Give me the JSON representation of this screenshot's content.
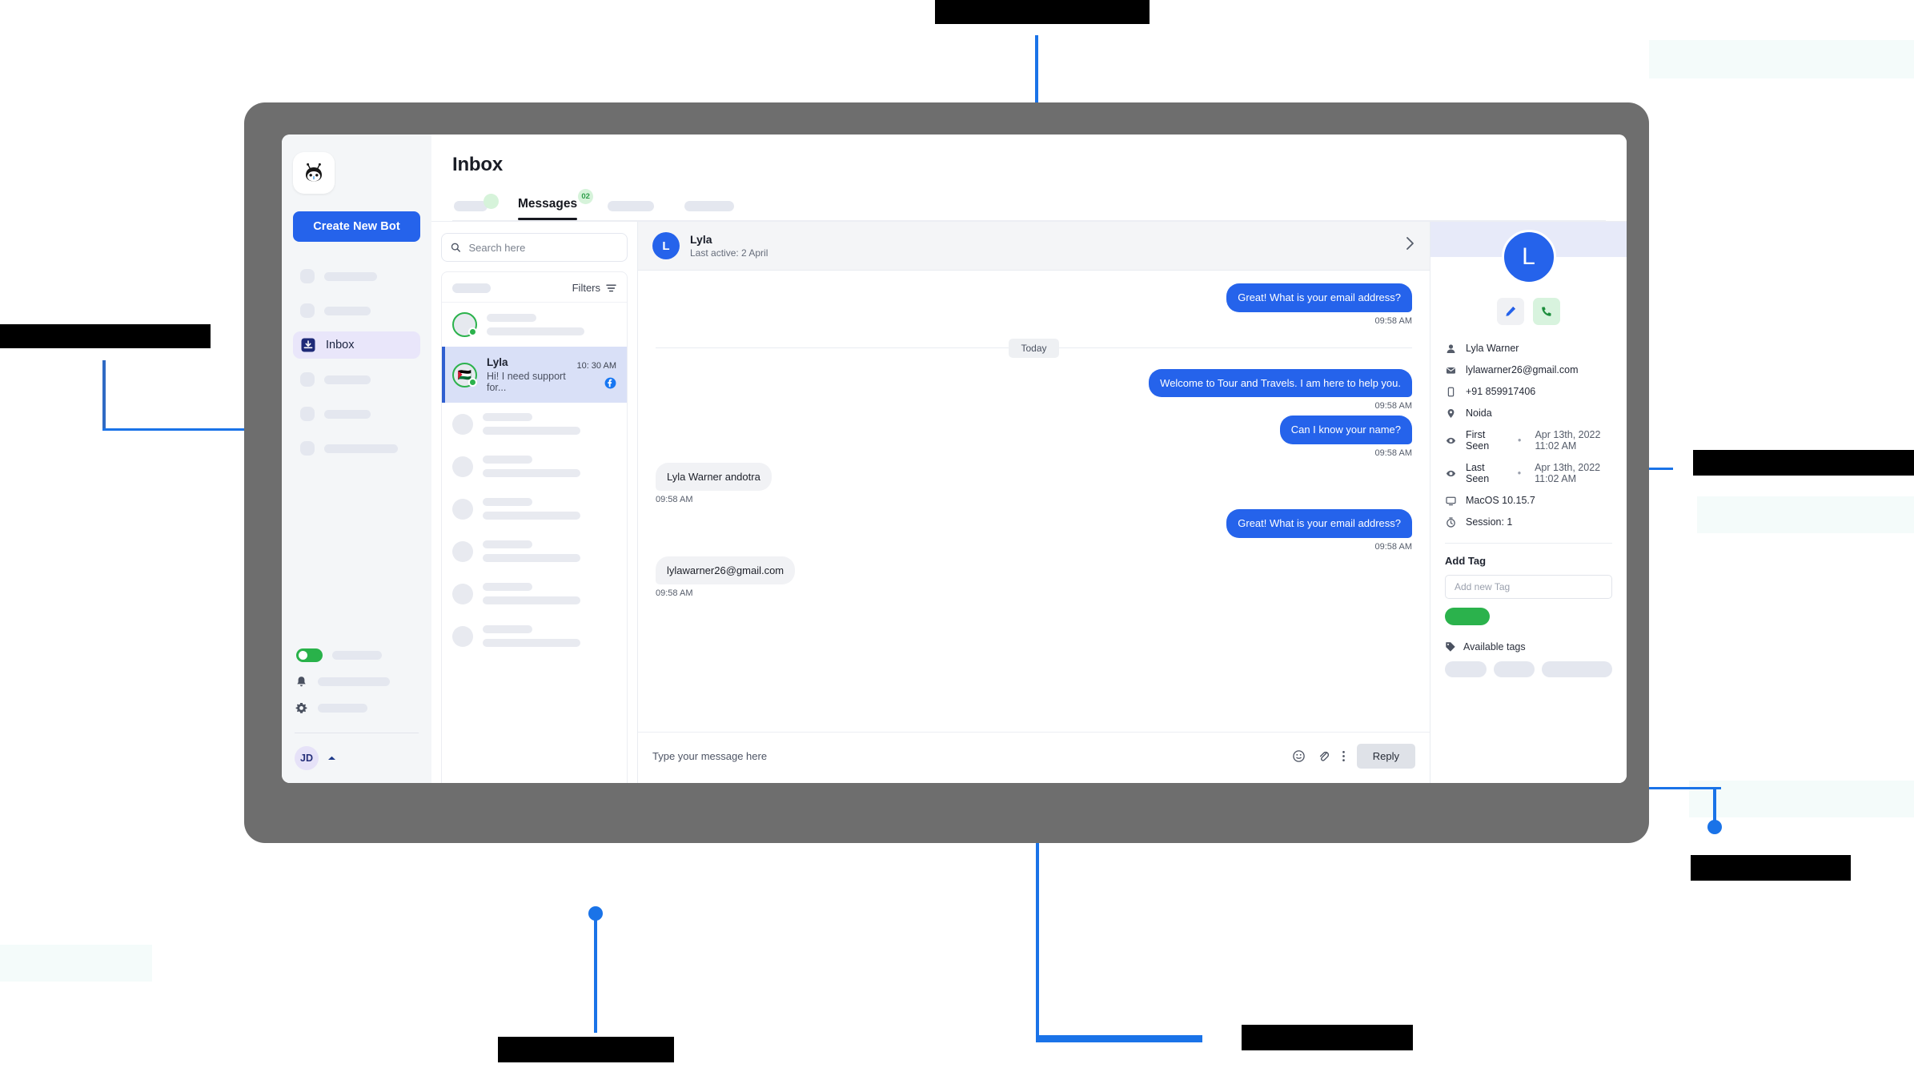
{
  "sidebar": {
    "logo_icon": "bot-mascot-icon",
    "create_button": "Create New Bot",
    "active_item": {
      "label": "Inbox",
      "icon": "inbox-icon"
    },
    "skeleton_items_above": 2,
    "skeleton_items_below": 3,
    "toggle_state": "on",
    "bell_icon": "bell-icon",
    "gear_icon": "gear-icon",
    "user_initials": "JD",
    "user_chevron": "chevron-up-icon"
  },
  "header": {
    "title": "Inbox"
  },
  "tabs": [
    {
      "label": "",
      "type": "skeleton",
      "has_green_dot": true
    },
    {
      "label": "Messages",
      "type": "text",
      "active": true,
      "badge": "02"
    },
    {
      "label": "",
      "type": "skeleton"
    },
    {
      "label": "",
      "type": "skeleton"
    }
  ],
  "conversation_list": {
    "search_placeholder": "Search here",
    "search_value": "",
    "search_icon": "search-icon",
    "filters_label": "Filters",
    "filters_icon": "filter-icon",
    "items": [
      {
        "name": "Lyla",
        "snippet": "Hi! I need support for...",
        "time": "10: 30 AM",
        "channel_icon": "facebook-icon",
        "avatar_emoji": "🇵🇸",
        "selected": true,
        "online": true
      }
    ],
    "skeleton_rows": 6
  },
  "chat": {
    "contact_name": "Lyla",
    "contact_status": "Last active: 2 April",
    "avatar_initial": "L",
    "expand_icon": "chevron-right-icon",
    "day_separator": "Today",
    "messages": [
      {
        "dir": "out",
        "text": "Great! What is your email address?",
        "time": "09:58 AM"
      },
      {
        "dir": "out",
        "text": "Welcome to Tour and Travels. I am here to help you.",
        "time": "09:58 AM"
      },
      {
        "dir": "out",
        "text": "Can I know your name?",
        "time": "09:58 AM"
      },
      {
        "dir": "in",
        "text": "Lyla Warner andotra",
        "time": "09:58 AM"
      },
      {
        "dir": "out",
        "text": "Great! What is your email address?",
        "time": "09:58 AM"
      },
      {
        "dir": "in",
        "text": "lylawarner26@gmail.com",
        "time": "09:58 AM"
      }
    ],
    "composer": {
      "placeholder": "Type your message here",
      "emoji_icon": "emoji-icon",
      "attach_icon": "paperclip-icon",
      "more_icon": "more-vertical-icon",
      "reply_label": "Reply"
    }
  },
  "details": {
    "avatar_initial": "L",
    "edit_icon": "pencil-icon",
    "call_icon": "phone-icon",
    "fields": [
      {
        "icon": "person-icon",
        "label": "Lyla Warner",
        "value": ""
      },
      {
        "icon": "mail-icon",
        "label": "lylawarner26@gmail.com",
        "value": ""
      },
      {
        "icon": "phone-icon",
        "label": "+91 859917406",
        "value": ""
      },
      {
        "icon": "pin-icon",
        "label": "Noida",
        "value": ""
      },
      {
        "icon": "eye-icon",
        "label": "First Seen",
        "sep": "•",
        "value": "Apr 13th, 2022 11:02 AM"
      },
      {
        "icon": "eye-icon",
        "label": "Last Seen",
        "sep": "•",
        "value": "Apr 13th, 2022 11:02 AM"
      },
      {
        "icon": "monitor-icon",
        "label": "MacOS 10.15.7",
        "value": ""
      },
      {
        "icon": "timer-icon",
        "label": "Session: 1",
        "value": ""
      }
    ],
    "tag_section_title": "Add Tag",
    "tag_input_placeholder": "Add new Tag",
    "tag_input_value": "",
    "add_tag_button_color": "#2bb24c",
    "available_tags_label": "Available tags",
    "available_tags_icon": "tag-icon",
    "available_tag_chips": 3
  },
  "annotations": [
    {
      "name": "default-inbox-callout",
      "position": "top"
    },
    {
      "name": "visitor-status-callout",
      "position": "left"
    },
    {
      "name": "visitor-details-callout",
      "position": "right"
    },
    {
      "name": "chat-tags-callout",
      "position": "bottom-right"
    },
    {
      "name": "visitor-list-callout",
      "position": "bottom-left"
    },
    {
      "name": "live-chat-callout",
      "position": "bottom"
    }
  ],
  "colors": {
    "brand_blue": "#2563eb",
    "accent_green": "#2bb24c",
    "frame_gray": "#6e6e6e",
    "connector_blue": "#1a73e8",
    "selected_row": "#d9e0f7"
  }
}
